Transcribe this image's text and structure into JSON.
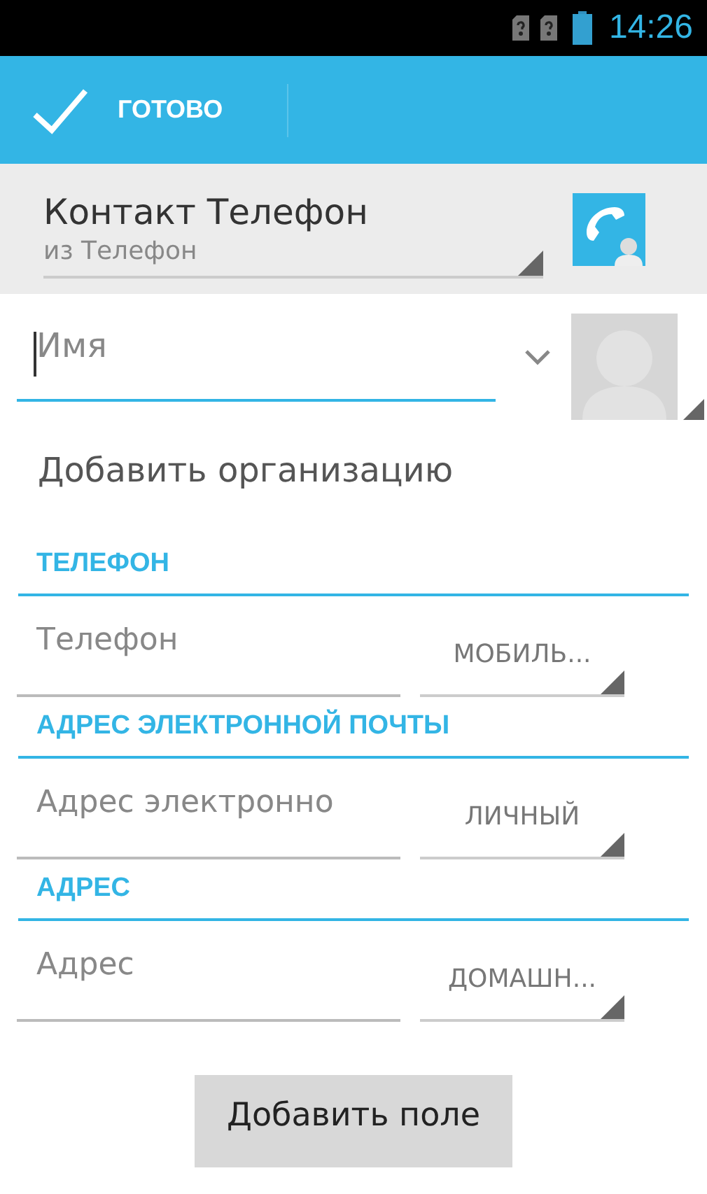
{
  "status_bar": {
    "time": "14:26"
  },
  "action_bar": {
    "done": "ГОТОВО"
  },
  "account": {
    "name": "Контакт Телефон",
    "source": "из Телефон"
  },
  "name_field": {
    "placeholder": "Имя",
    "focused": true
  },
  "add_organization": "Добавить организацию",
  "sections": [
    {
      "title": "ТЕЛЕФОН",
      "placeholder": "Телефон",
      "type": "МОБИЛЬ..."
    },
    {
      "title": "АДРЕС ЭЛЕКТРОННОЙ ПОЧТЫ",
      "placeholder": "Адрес электронно",
      "type": "ЛИЧНЫЙ"
    },
    {
      "title": "АДРЕС",
      "placeholder": "Адрес",
      "type": "ДОМАШН..."
    }
  ],
  "add_field_button": "Добавить поле"
}
